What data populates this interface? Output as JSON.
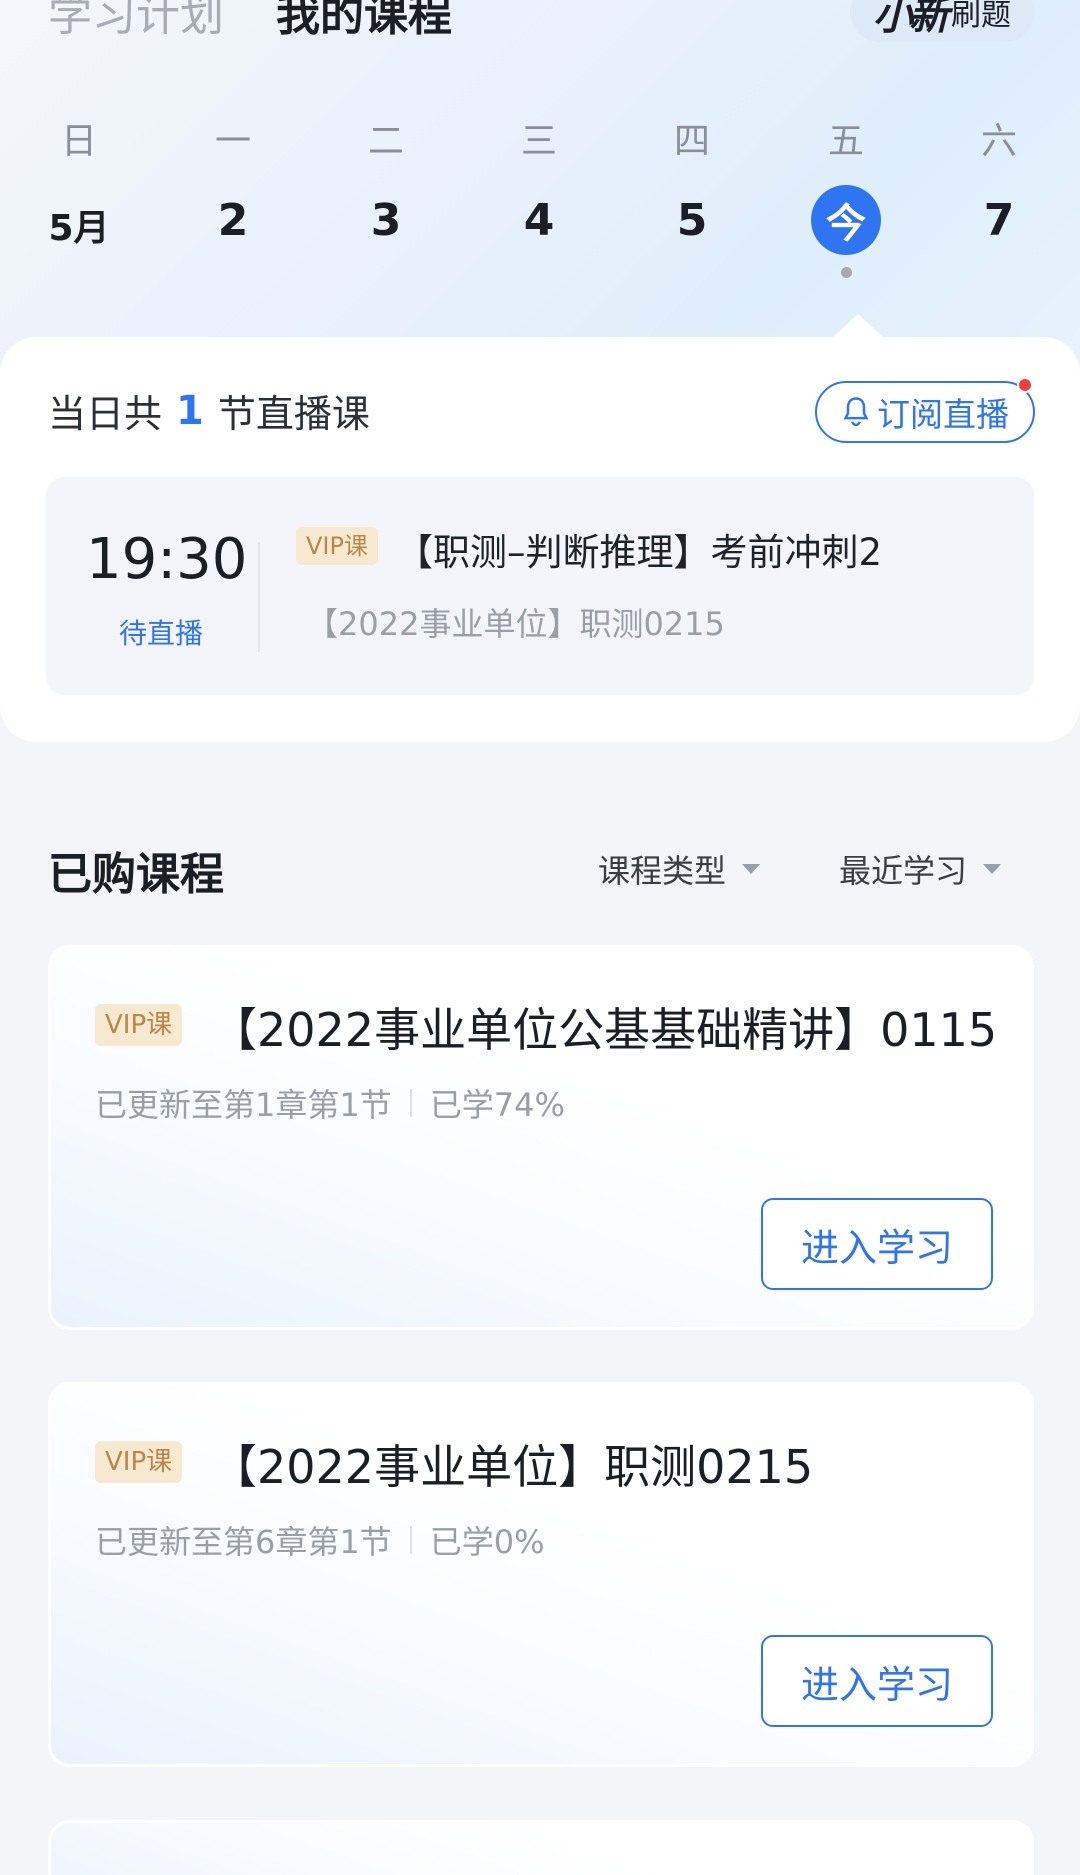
{
  "header": {
    "tabs": [
      "学习计划",
      "我的课程"
    ],
    "brush_button": {
      "logo": "小新",
      "label": "刷题"
    }
  },
  "week": {
    "weekdays": [
      "日",
      "一",
      "二",
      "三",
      "四",
      "五",
      "六"
    ],
    "dates": [
      "5月",
      "2",
      "3",
      "4",
      "5",
      "今",
      "7"
    ]
  },
  "live": {
    "count_prefix": "当日共",
    "count": "1",
    "count_suffix": "节直播课",
    "subscribe_label": "订阅直播",
    "item": {
      "time": "19:30",
      "status": "待直播",
      "vip": "VIP课",
      "title": "【职测–判断推理】考前冲刺2",
      "course": "【2022事业单位】职测0215"
    }
  },
  "purchased": {
    "title": "已购课程",
    "filters": [
      "课程类型",
      "最近学习"
    ],
    "courses": [
      {
        "vip": "VIP课",
        "title": "【2022事业单位公基基础精讲】0115",
        "update": "已更新至第1章第1节",
        "progress": "已学74%",
        "button": "进入学习"
      },
      {
        "vip": "VIP课",
        "title": "【2022事业单位】职测0215",
        "update": "已更新至第6章第1节",
        "progress": "已学0%",
        "button": "进入学习"
      }
    ]
  },
  "colors": {
    "accent": "#2f74f0",
    "vip_bg": "#f7e9cf",
    "vip_text": "#b8874a",
    "badge_red": "#ef3e3e"
  }
}
